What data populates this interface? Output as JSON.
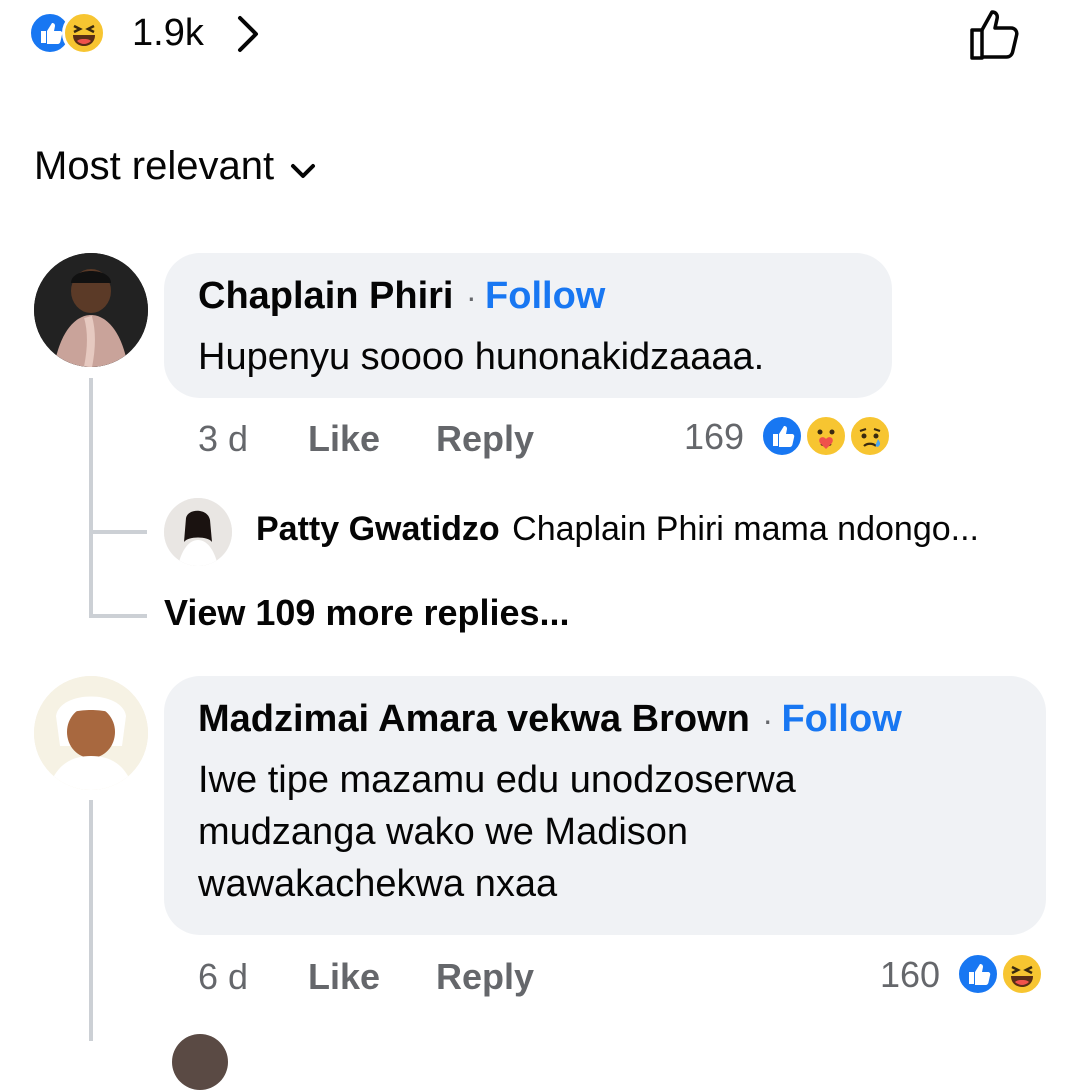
{
  "header": {
    "reaction_count": "1.9k",
    "reaction_icons": [
      "like-icon",
      "haha-icon"
    ],
    "chevron_icon": "chevron-right-icon",
    "like_button_icon": "thumbs-up-outline-icon"
  },
  "sort": {
    "label": "Most relevant"
  },
  "colors": {
    "accent": "#1877f2",
    "bubble": "#f0f2f5",
    "muted": "#65676b"
  },
  "comments": [
    {
      "author": "Chaplain Phiri",
      "follow": "Follow",
      "separator": "·",
      "text": [
        "Hupenyu soooo hunonakidzaaaa."
      ],
      "time": "3 d",
      "like": "Like",
      "reply": "Reply",
      "reaction_count": "169",
      "reactions": [
        "like-icon",
        "care-icon",
        "sad-icon"
      ],
      "replies_preview": {
        "author": "Patty Gwatidzo",
        "text": "Chaplain Phiri mama ndongo..."
      },
      "more_replies": "View 109 more replies..."
    },
    {
      "author": "Madzimai Amara vekwa Brown",
      "follow": "Follow",
      "separator": "·",
      "text": [
        "Iwe tipe mazamu edu unodzoserwa",
        "mudzanga wako we Madison",
        "wawakachekwa nxaa"
      ],
      "time": "6 d",
      "like": "Like",
      "reply": "Reply",
      "reaction_count": "160",
      "reactions": [
        "like-icon",
        "haha-icon"
      ]
    }
  ]
}
